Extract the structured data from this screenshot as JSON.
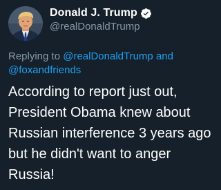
{
  "user": {
    "display_name": "Donald J. Trump",
    "handle": "@realDonaldTrump",
    "verified": true,
    "verified_icon": "verified-badge-icon",
    "avatar": "profile-photo"
  },
  "reply": {
    "prefix": "Replying to",
    "mention1": "@realDonaldTrump",
    "joiner": "and",
    "mention2": "@foxandfriends"
  },
  "tweet": {
    "text": "According to report just out, President Obama knew about Russian interference 3 years ago but he didn't want to anger Russia!"
  },
  "colors": {
    "background": "#15202B",
    "secondary_text": "#8899A6",
    "accent": "#1DA1F2",
    "primary_text": "#FFFFFF"
  }
}
